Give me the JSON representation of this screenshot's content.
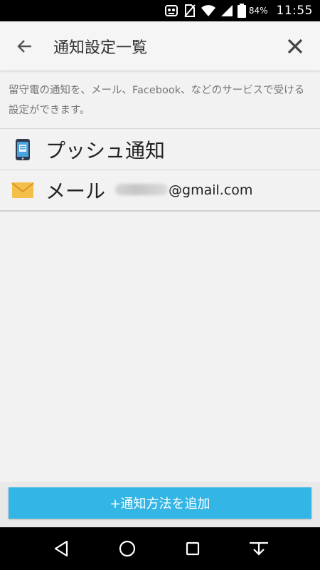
{
  "status_bar": {
    "battery_percent": "84%",
    "time": "11:55"
  },
  "toolbar": {
    "title": "通知設定一覧"
  },
  "description": "留守電の通知を、メール、Facebook、などのサービスで受ける設定ができます。",
  "items": [
    {
      "label": "プッシュ通知",
      "icon": "smartphone-icon"
    },
    {
      "label": "メール",
      "icon": "envelope-icon",
      "email_domain": "@gmail.com"
    }
  ],
  "add_button": {
    "label": "+通知方法を追加",
    "color": "#33b5e5"
  },
  "nav_bar": {
    "buttons": [
      "back-icon",
      "home-icon",
      "recents-icon",
      "hide-keyboard-icon"
    ]
  }
}
